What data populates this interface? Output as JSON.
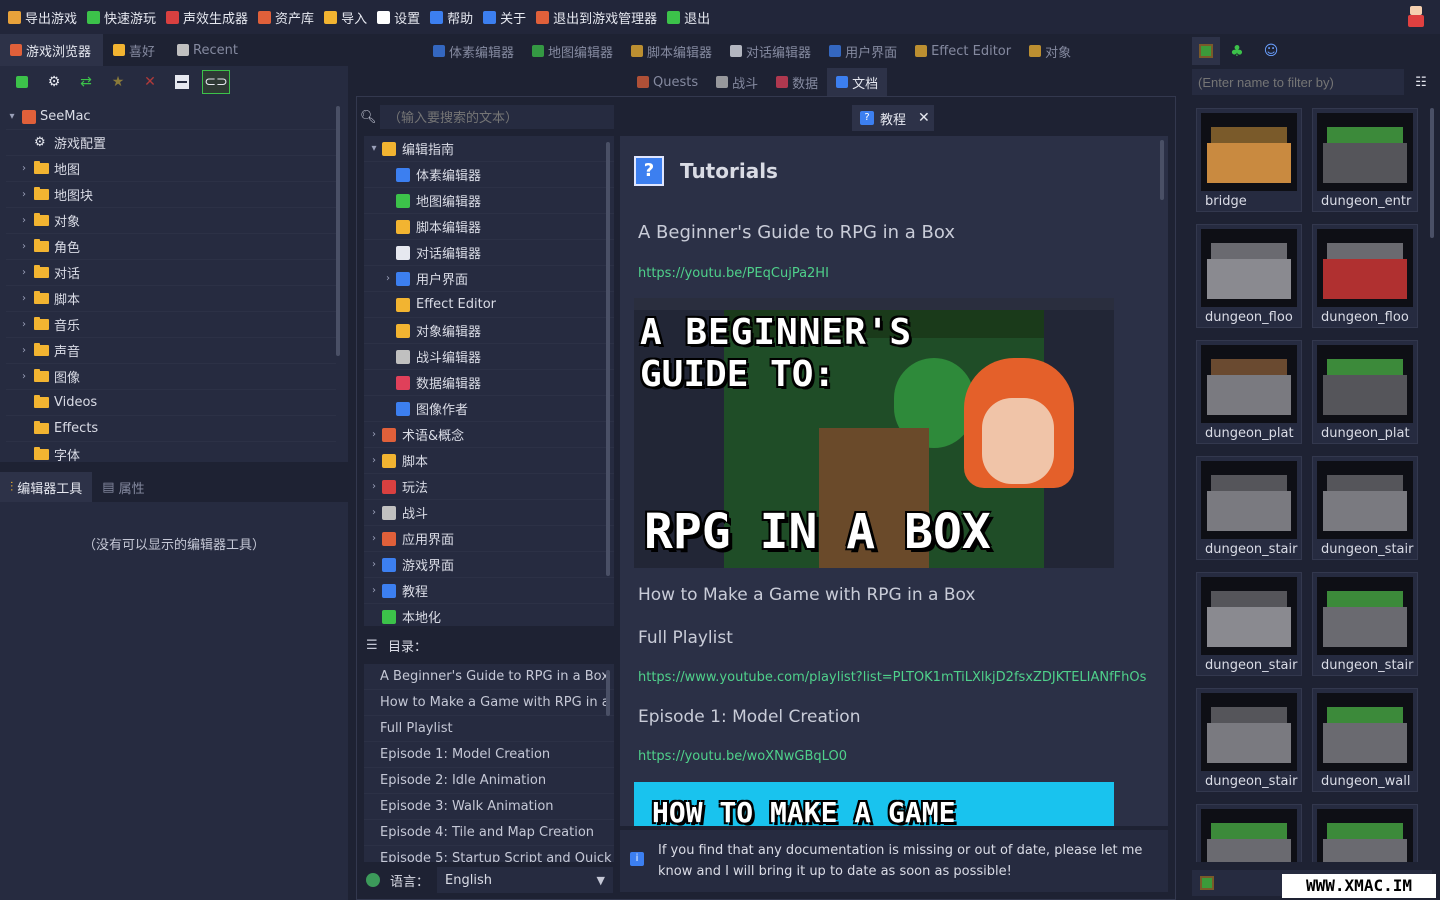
{
  "menubar": {
    "items": [
      {
        "label": "导出游戏",
        "icon": "export-game-icon",
        "color": "#e8a23b"
      },
      {
        "label": "快速游玩",
        "icon": "play-icon",
        "color": "#3cc24a"
      },
      {
        "label": "声效生成器",
        "icon": "speaker-icon",
        "color": "#d94040"
      },
      {
        "label": "资产库",
        "icon": "asset-library-icon",
        "color": "#e0603a"
      },
      {
        "label": "导入",
        "icon": "import-icon",
        "color": "#f2b431"
      },
      {
        "label": "设置",
        "icon": "gear-icon",
        "color": "#ffffff"
      },
      {
        "label": "帮助",
        "icon": "help-icon",
        "color": "#3c7ff0"
      },
      {
        "label": "关于",
        "icon": "info-icon",
        "color": "#3c7ff0"
      },
      {
        "label": "退出到游戏管理器",
        "icon": "exit-manager-icon",
        "color": "#e0603a"
      },
      {
        "label": "退出",
        "icon": "quit-icon",
        "color": "#3cc24a"
      }
    ]
  },
  "left_tabs": [
    {
      "label": "游戏浏览器",
      "icon": "game-browser-icon",
      "active": true
    },
    {
      "label": "喜好",
      "icon": "star-icon",
      "active": false
    },
    {
      "label": "Recent",
      "icon": "hourglass-icon",
      "active": false
    }
  ],
  "tree": {
    "root": "SeeMac",
    "items": [
      {
        "label": "游戏配置",
        "kind": "gear"
      },
      {
        "label": "地图",
        "kind": "folder",
        "arrow": true
      },
      {
        "label": "地图块",
        "kind": "folder",
        "arrow": true
      },
      {
        "label": "对象",
        "kind": "folder",
        "arrow": true
      },
      {
        "label": "角色",
        "kind": "folder",
        "arrow": true
      },
      {
        "label": "对话",
        "kind": "folder",
        "arrow": true
      },
      {
        "label": "脚本",
        "kind": "folder",
        "arrow": true
      },
      {
        "label": "音乐",
        "kind": "folder",
        "arrow": true
      },
      {
        "label": "声音",
        "kind": "folder",
        "arrow": true
      },
      {
        "label": "图像",
        "kind": "folder",
        "arrow": true
      },
      {
        "label": "Videos",
        "kind": "folder",
        "arrow": false
      },
      {
        "label": "Effects",
        "kind": "folder",
        "arrow": false
      },
      {
        "label": "字体",
        "kind": "folder",
        "arrow": false
      }
    ]
  },
  "tools_tabs": [
    {
      "label": "编辑器工具",
      "active": true
    },
    {
      "label": "属性",
      "active": false
    }
  ],
  "tools_empty": "（没有可以显示的编辑器工具）",
  "editor_tabs_row1": [
    {
      "label": "体素编辑器",
      "color": "#3c7ff0"
    },
    {
      "label": "地图编辑器",
      "color": "#3cc24a"
    },
    {
      "label": "脚本编辑器",
      "color": "#f2b431"
    },
    {
      "label": "对话编辑器",
      "color": "#e6e8f0"
    },
    {
      "label": "用户界面",
      "color": "#3c7ff0"
    },
    {
      "label": "Effect Editor",
      "color": "#f2b431"
    },
    {
      "label": "对象",
      "color": "#f2b431"
    }
  ],
  "editor_tabs_row2": [
    {
      "label": "Quests",
      "color": "#e0603a",
      "active": false
    },
    {
      "label": "战斗",
      "color": "#c0c0c0",
      "active": false
    },
    {
      "label": "数据",
      "color": "#e0405a",
      "active": false
    },
    {
      "label": "文档",
      "color": "#3c7ff0",
      "active": true
    }
  ],
  "docs": {
    "search_placeholder": "（输入要搜索的文本）",
    "open_tab": "教程",
    "doc_tree": [
      {
        "label": "编辑指南",
        "depth": 0,
        "arrow": "down",
        "color": "#f2b431"
      },
      {
        "label": "体素编辑器",
        "depth": 1,
        "arrow": "",
        "color": "#3c7ff0"
      },
      {
        "label": "地图编辑器",
        "depth": 1,
        "arrow": "",
        "color": "#3cc24a"
      },
      {
        "label": "脚本编辑器",
        "depth": 1,
        "arrow": "",
        "color": "#f2b431"
      },
      {
        "label": "对话编辑器",
        "depth": 1,
        "arrow": "",
        "color": "#e6e8f0"
      },
      {
        "label": "用户界面",
        "depth": 1,
        "arrow": "right",
        "color": "#3c7ff0"
      },
      {
        "label": "Effect Editor",
        "depth": 1,
        "arrow": "",
        "color": "#f2b431"
      },
      {
        "label": "对象编辑器",
        "depth": 1,
        "arrow": "",
        "color": "#f2b431"
      },
      {
        "label": "战斗编辑器",
        "depth": 1,
        "arrow": "",
        "color": "#c0c0c0"
      },
      {
        "label": "数据编辑器",
        "depth": 1,
        "arrow": "",
        "color": "#e0405a"
      },
      {
        "label": "图像作者",
        "depth": 1,
        "arrow": "",
        "color": "#3c7ff0"
      },
      {
        "label": "术语&概念",
        "depth": 0,
        "arrow": "right",
        "color": "#e0603a"
      },
      {
        "label": "脚本",
        "depth": 0,
        "arrow": "right",
        "color": "#f2b431"
      },
      {
        "label": "玩法",
        "depth": 0,
        "arrow": "right",
        "color": "#d94040"
      },
      {
        "label": "战斗",
        "depth": 0,
        "arrow": "right",
        "color": "#c0c0c0"
      },
      {
        "label": "应用界面",
        "depth": 0,
        "arrow": "right",
        "color": "#e0603a"
      },
      {
        "label": "游戏界面",
        "depth": 0,
        "arrow": "right",
        "color": "#3c7ff0"
      },
      {
        "label": "教程",
        "depth": 0,
        "arrow": "right",
        "color": "#3c7ff0"
      },
      {
        "label": "本地化",
        "depth": 0,
        "arrow": "",
        "color": "#3cc24a"
      }
    ],
    "toc_label": "目录：",
    "toc": [
      "A Beginner's Guide to RPG in a Box",
      "How to Make a Game with RPG in a Box",
      "Full Playlist",
      "Episode 1: Model Creation",
      "Episode 2: Idle Animation",
      "Episode 3: Walk Animation",
      "Episode 4: Tile and Map Creation",
      "Episode 5: Startup Script and Quick"
    ],
    "language_label": "语言：",
    "language_value": "English",
    "content": {
      "title": "Tutorials",
      "h_beginner": "A Beginner's Guide to RPG in a Box",
      "link_beginner": "https://youtu.be/PEqCujPa2HI",
      "thumb1_line1": "A BEGINNER'S",
      "thumb1_line2": "GUIDE TO:",
      "thumb1_line3": "RPG IN A BOX",
      "h_howto": "How to Make a Game with RPG in a Box",
      "h_playlist": "Full Playlist",
      "link_playlist": "https://www.youtube.com/playlist?list=PLTOK1mTiLXlkjD2fsxZDJKTELIANfFhOs",
      "h_ep1": "Episode 1: Model Creation",
      "link_ep1": "https://youtu.be/woXNwGBqLO0",
      "thumb2_text": "HOW TO MAKE A GAME"
    },
    "notice": "If you find that any documentation is missing or out of date, please let me know and I will bring it up to date as soon as possible!"
  },
  "assets": {
    "filter_placeholder": "(Enter name to filter by)",
    "items": [
      "bridge",
      "dungeon_entr",
      "dungeon_floo",
      "dungeon_floo",
      "dungeon_plat",
      "dungeon_plat",
      "dungeon_stair",
      "dungeon_stair",
      "dungeon_stair",
      "dungeon_stair",
      "dungeon_stair",
      "dungeon_wall",
      "",
      ""
    ]
  },
  "watermark": "WWW.XMAC.IM"
}
